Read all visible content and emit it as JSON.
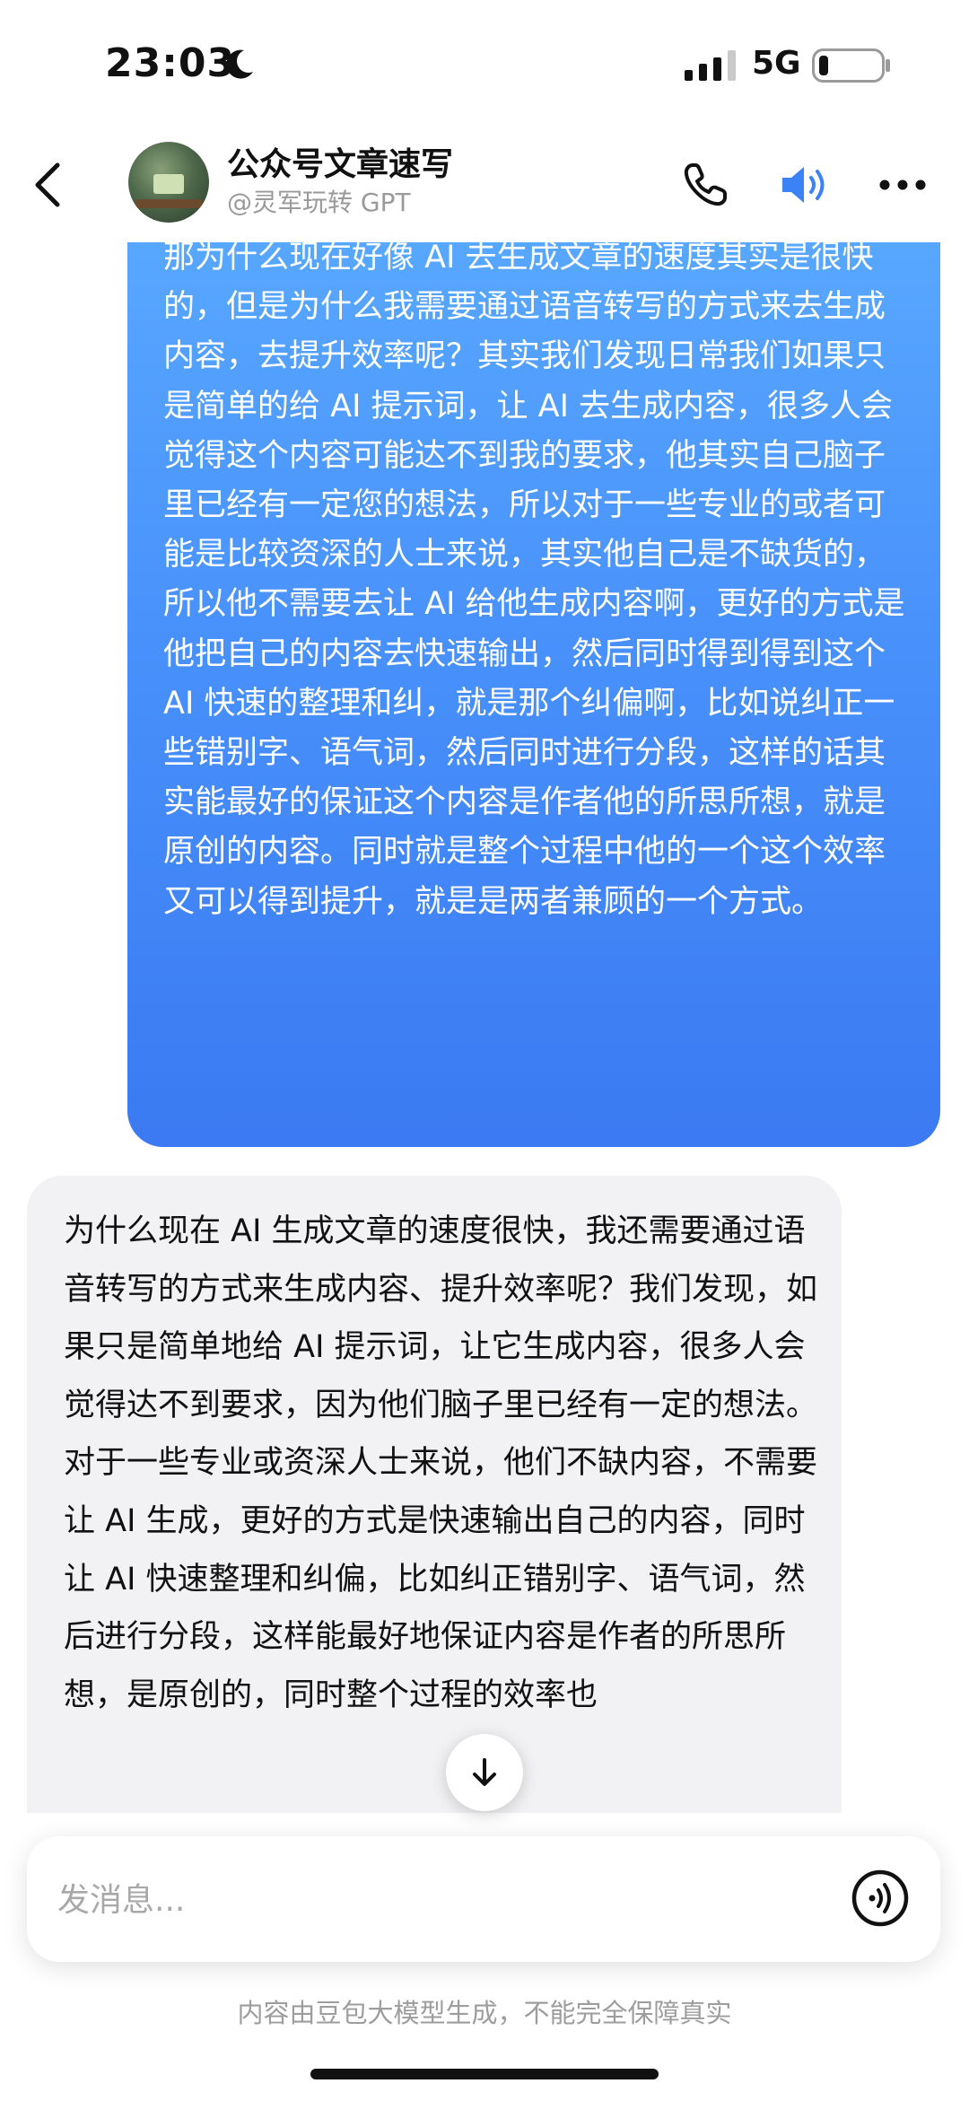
{
  "status_bar": {
    "time": "23:03",
    "moon_icon": "moon-icon",
    "signal_icon": "cellular-signal-icon",
    "network": "5G",
    "battery_icon": "battery-icon"
  },
  "header": {
    "back_icon": "chevron-left-icon",
    "title": "公众号文章速写",
    "subtitle": "@灵军玩转 GPT",
    "phone_icon": "phone-icon",
    "speaker_icon": "speaker-icon",
    "more_icon": "more-dots-icon",
    "speaker_color": "#3b82f6"
  },
  "messages": {
    "user": {
      "text": "那为什么现在好像 AI 去生成文章的速度其实是很快的，但是为什么我需要通过语音转写的方式来去生成内容，去提升效率呢？其实我们发现日常我们如果只是简单的给 AI 提示词，让 AI 去生成内容，很多人会觉得这个内容可能达不到我的要求，他其实自己脑子里已经有一定您的想法，所以对于一些专业的或者可能是比较资深的人士来说，其实他自己是不缺货的，所以他不需要去让 AI 给他生成内容啊，更好的方式是他把自己的内容去快速输出，然后同时得到得到这个 AI 快速的整理和纠，就是那个纠偏啊，比如说纠正一些错别字、语气词，然后同时进行分段，这样的话其实能最好的保证这个内容是作者他的所思所想，就是原创的内容。同时就是整个过程中他的一个这个效率又可以得到提升，就是是两者兼顾的一个方式。",
      "bubble_color_top": "#58a8ff",
      "bubble_color_bottom": "#3b7af2"
    },
    "assistant": {
      "text": "为什么现在 AI 生成文章的速度很快，我还需要通过语音转写的方式来生成内容、提升效率呢？我们发现，如果只是简单地给 AI 提示词，让它生成内容，很多人会觉得达不到要求，因为他们脑子里已经有一定的想法。对于一些专业或资深人士来说，他们不缺内容，不需要让 AI 生成，更好的方式是快速输出自己的内容，同时让 AI 快速整理和纠偏，比如纠正错别字、语气词，然后进行分段，这样能最好地保证内容是作者的所思所想，是原创的，同时整个过程的效率也",
      "bubble_color": "#f2f2f4"
    }
  },
  "scroll_down": {
    "icon": "arrow-down-icon"
  },
  "input": {
    "placeholder": "发消息...",
    "voice_icon": "voice-wave-icon"
  },
  "footer": {
    "disclaimer": "内容由豆包大模型生成，不能完全保障真实"
  }
}
